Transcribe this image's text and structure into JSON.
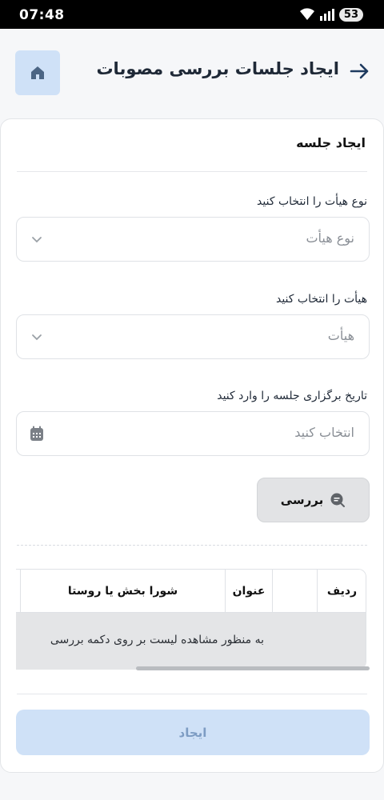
{
  "status": {
    "time": "07:48",
    "battery": "53"
  },
  "header": {
    "title": "ایجاد جلسات بررسی مصوبات"
  },
  "card": {
    "title": "ایجاد جلسه",
    "board_type": {
      "label": "نوع هیأت را انتخاب کنید",
      "placeholder": "نوع هیأت"
    },
    "board": {
      "label": "هیأت را انتخاب کنید",
      "placeholder": "هیأت"
    },
    "date": {
      "label": "تاریخ برگزاری جلسه را وارد کنید",
      "placeholder": "انتخاب کنید"
    },
    "search_label": "بررسی",
    "table": {
      "columns": [
        "ردیف",
        "",
        "عنوان",
        "شورا بخش یا روستا"
      ],
      "empty_message": "به منظور مشاهده لیست بر روی دکمه بررسی"
    },
    "create_label": "ایجاد"
  },
  "colors": {
    "accent_light": "#cfe1f7",
    "accent_text": "#7d9cc3",
    "arrow": "#1e3a5f"
  }
}
